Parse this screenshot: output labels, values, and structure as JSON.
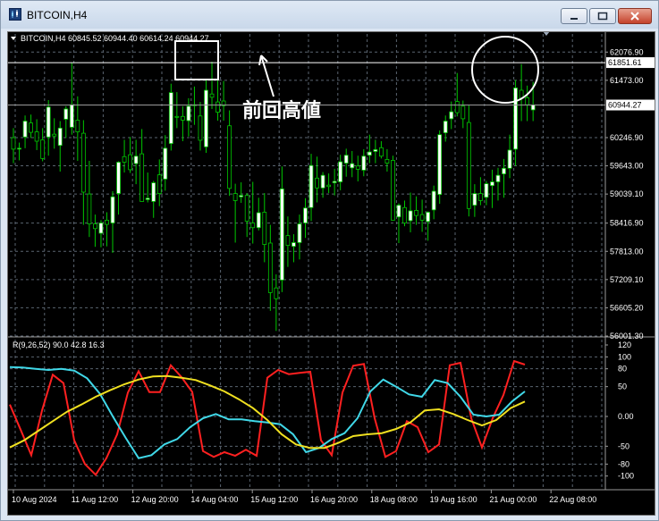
{
  "window": {
    "title": "BITCOIN,H4"
  },
  "chart_header": {
    "info": "BITCOIN,H4  60845.52 60944.40 60614.24 60944.27"
  },
  "price_axis": {
    "labels": [
      "62076.90",
      "61473.00",
      "60246.90",
      "59643.00",
      "59039.10",
      "58416.90",
      "57813.00",
      "57209.10",
      "56605.20",
      "56001.30"
    ],
    "high_line_label": "61851.61",
    "current_label": "60944.27"
  },
  "annotation": {
    "text": "前回高値"
  },
  "indicator": {
    "label": "R(9,26,52) 90.0 42.8 16.3",
    "axis_labels": [
      "120",
      "100",
      "80",
      "50",
      "0.00",
      "-50",
      "-80",
      "-100"
    ]
  },
  "time_axis": {
    "labels": [
      "10 Aug 2024",
      "11 Aug 12:00",
      "12 Aug 20:00",
      "14 Aug 04:00",
      "15 Aug 12:00",
      "16 Aug 20:00",
      "18 Aug 08:00",
      "19 Aug 16:00",
      "21 Aug 00:00",
      "22 Aug 08:00"
    ]
  },
  "colors": {
    "chart_bg": "#000000",
    "bull_candle": "#ffffff",
    "bear_candle": "#000000",
    "wick": "#00c800",
    "grid": "#5a6470",
    "red_line": "#ff2020",
    "cyan_line": "#40d8e8",
    "yellow_line": "#f0e020"
  },
  "chart_data": [
    {
      "type": "candlestick",
      "series": [
        {
          "name": "BITCOIN,H4",
          "ohlc": [
            [
              60245,
              60450,
              59700,
              60000
            ],
            [
              60020,
              60140,
              59760,
              60020
            ],
            [
              60260,
              60720,
              60020,
              60600
            ],
            [
              60560,
              60740,
              60240,
              60360
            ],
            [
              60370,
              60640,
              59980,
              60170
            ],
            [
              60200,
              60450,
              59740,
              59800
            ],
            [
              60260,
              61050,
              59860,
              60900
            ],
            [
              60320,
              60660,
              60010,
              60280
            ],
            [
              60080,
              60600,
              59520,
              60450
            ],
            [
              60640,
              60920,
              60240,
              60860
            ],
            [
              60470,
              61850,
              60310,
              60950
            ],
            [
              60620,
              61130,
              59750,
              60370
            ],
            [
              60340,
              60620,
              58380,
              59080
            ],
            [
              59040,
              59750,
              58120,
              58400
            ],
            [
              58400,
              58600,
              57910,
              58300
            ],
            [
              58200,
              58480,
              57900,
              58420
            ],
            [
              58480,
              58650,
              57920,
              58390
            ],
            [
              58420,
              59100,
              57780,
              58980
            ],
            [
              59050,
              59740,
              58600,
              59720
            ],
            [
              59840,
              60200,
              59500,
              59720
            ],
            [
              59880,
              60260,
              59490,
              59560
            ],
            [
              59690,
              60200,
              59250,
              59850
            ],
            [
              59900,
              60430,
              59200,
              58880
            ],
            [
              58920,
              59500,
              58860,
              58950
            ],
            [
              58880,
              59320,
              58530,
              59280
            ],
            [
              59450,
              59780,
              58780,
              59050
            ],
            [
              59360,
              60300,
              59110,
              60020
            ],
            [
              60120,
              61400,
              59970,
              61210
            ],
            [
              60700,
              61220,
              60450,
              60680
            ],
            [
              60700,
              60920,
              60170,
              60620
            ],
            [
              60610,
              61090,
              60270,
              60920
            ],
            [
              60940,
              61340,
              60520,
              60950
            ],
            [
              60710,
              61010,
              59970,
              60190
            ],
            [
              60050,
              61500,
              59920,
              61260
            ],
            [
              61180,
              61870,
              60860,
              61110
            ],
            [
              61010,
              61500,
              60610,
              60790
            ],
            [
              61030,
              61460,
              60610,
              60930
            ],
            [
              60500,
              60830,
              59000,
              59160
            ],
            [
              59050,
              59260,
              58000,
              58900
            ],
            [
              58980,
              59290,
              58850,
              59010
            ],
            [
              59010,
              59060,
              58120,
              58460
            ],
            [
              58420,
              59300,
              57980,
              58320
            ],
            [
              58320,
              58960,
              58260,
              58640
            ],
            [
              58650,
              59060,
              57580,
              57960
            ],
            [
              57990,
              58380,
              56540,
              56930
            ],
            [
              57030,
              57320,
              56110,
              56800
            ],
            [
              57200,
              59630,
              56940,
              59150
            ],
            [
              58150,
              58560,
              57480,
              57940
            ],
            [
              57920,
              58180,
              57580,
              58000
            ],
            [
              58000,
              58600,
              57640,
              58400
            ],
            [
              58420,
              58950,
              58100,
              58740
            ],
            [
              58750,
              59900,
              58460,
              59650
            ],
            [
              59380,
              59840,
              58860,
              59170
            ],
            [
              59170,
              59510,
              58960,
              59440
            ],
            [
              59230,
              59480,
              59060,
              59200
            ],
            [
              59280,
              59580,
              59010,
              59310
            ],
            [
              59300,
              59880,
              59120,
              59730
            ],
            [
              59700,
              60010,
              59410,
              59870
            ],
            [
              59600,
              59960,
              59400,
              59690
            ],
            [
              59640,
              59860,
              59310,
              59570
            ],
            [
              59550,
              60000,
              59420,
              59850
            ],
            [
              59870,
              60310,
              59700,
              59940
            ],
            [
              59950,
              60200,
              59700,
              59990
            ],
            [
              60030,
              60170,
              59800,
              59850
            ],
            [
              59780,
              60000,
              59520,
              59700
            ],
            [
              59760,
              59860,
              58580,
              58480
            ],
            [
              58550,
              58840,
              57990,
              58800
            ],
            [
              58750,
              58900,
              58350,
              58420
            ],
            [
              58470,
              59070,
              58220,
              58680
            ],
            [
              58690,
              58990,
              58380,
              58580
            ],
            [
              58600,
              58920,
              58230,
              58480
            ],
            [
              58450,
              58670,
              58040,
              58650
            ],
            [
              58700,
              59220,
              58500,
              59100
            ],
            [
              59030,
              60400,
              58830,
              60310
            ],
            [
              60350,
              60720,
              60160,
              60600
            ],
            [
              60650,
              61020,
              60430,
              60800
            ],
            [
              61020,
              61630,
              60700,
              60780
            ],
            [
              60920,
              61040,
              60450,
              60650
            ],
            [
              60570,
              60950,
              58560,
              58730
            ],
            [
              58800,
              59250,
              58550,
              59050
            ],
            [
              59050,
              59400,
              58800,
              58900
            ],
            [
              58970,
              59320,
              58800,
              59260
            ],
            [
              59220,
              59560,
              58740,
              59300
            ],
            [
              59300,
              59600,
              58900,
              59440
            ],
            [
              59470,
              59790,
              58960,
              59590
            ],
            [
              59590,
              60310,
              59380,
              59980
            ],
            [
              60000,
              61480,
              59640,
              61310
            ],
            [
              61260,
              61820,
              60600,
              61090
            ],
            [
              61100,
              61360,
              60600,
              60950
            ],
            [
              60840,
              61440,
              60600,
              60944
            ]
          ]
        }
      ]
    },
    {
      "type": "line",
      "series": [
        {
          "name": "red",
          "values": [
            20,
            -22,
            -65,
            10,
            70,
            56,
            -40,
            -80,
            -98,
            -70,
            -30,
            40,
            76,
            41,
            41,
            86,
            66,
            41,
            -58,
            -68,
            -60,
            -66,
            -56,
            -66,
            65,
            78,
            71,
            73,
            75,
            -40,
            -65,
            40,
            85,
            88,
            -3,
            -68,
            -58,
            -8,
            -18,
            -60,
            -47,
            86,
            90,
            -3,
            -52,
            -3,
            36,
            93,
            87
          ]
        },
        {
          "name": "cyan",
          "values": [
            83,
            82,
            80,
            78,
            80,
            77,
            64,
            38,
            0,
            -36,
            -70,
            -65,
            -47,
            -38,
            -18,
            -3,
            4,
            -5,
            -5,
            -8,
            -10,
            -13,
            -30,
            -60,
            -53,
            -38,
            -28,
            -3,
            42,
            62,
            50,
            37,
            33,
            61,
            56,
            33,
            3,
            0,
            3,
            25,
            42
          ]
        },
        {
          "name": "yellow",
          "values": [
            -52,
            -40,
            -24,
            -8,
            8,
            20,
            33,
            44,
            54,
            62,
            67,
            68,
            65,
            61,
            52,
            42,
            29,
            14,
            -6,
            -30,
            -47,
            -53,
            -53,
            -44,
            -33,
            -30,
            -28,
            -21,
            -10,
            10,
            12,
            4,
            -6,
            -15,
            -6,
            14,
            25
          ]
        }
      ],
      "ylim": [
        -120,
        120
      ]
    }
  ]
}
